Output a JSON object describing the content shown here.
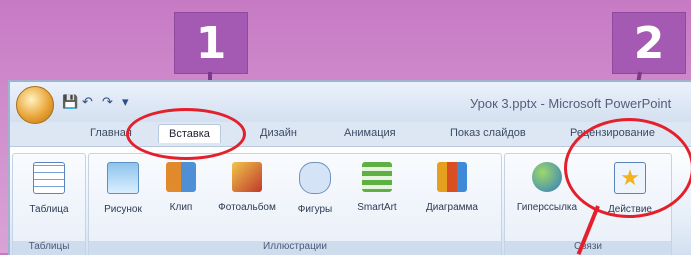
{
  "badges": {
    "first": "1",
    "second": "2"
  },
  "app": {
    "document_title": "Урок 3.pptx - Microsoft PowerPoint",
    "quick_access": {
      "save_icon": "save-icon",
      "undo_icon": "undo-icon",
      "redo_icon": "redo-icon"
    }
  },
  "tabs": [
    {
      "label": "Главная"
    },
    {
      "label": "Вставка",
      "active": true
    },
    {
      "label": "Дизайн"
    },
    {
      "label": "Анимация"
    },
    {
      "label": "Показ слайдов"
    },
    {
      "label": "Рецензирование"
    }
  ],
  "ribbon": {
    "groups": [
      {
        "label": "Таблицы",
        "buttons": [
          {
            "label": "Таблица",
            "icon": "table-icon"
          }
        ]
      },
      {
        "label": "Иллюстрации",
        "buttons": [
          {
            "label": "Рисунок",
            "icon": "picture-icon"
          },
          {
            "label": "Клип",
            "icon": "clipart-icon"
          },
          {
            "label": "Фотоальбом",
            "icon": "photo-album-icon"
          },
          {
            "label": "Фигуры",
            "icon": "shapes-icon"
          },
          {
            "label": "SmartArt",
            "icon": "smartart-icon"
          },
          {
            "label": "Диаграмма",
            "icon": "chart-icon"
          }
        ]
      },
      {
        "label": "Связи",
        "buttons": [
          {
            "label": "Гиперссылка",
            "icon": "hyperlink-icon"
          },
          {
            "label": "Действие",
            "icon": "action-icon"
          }
        ]
      }
    ]
  },
  "colors": {
    "annotation": "#e3202b",
    "badge": "#a45ab2",
    "background": "#cf8ccc"
  }
}
